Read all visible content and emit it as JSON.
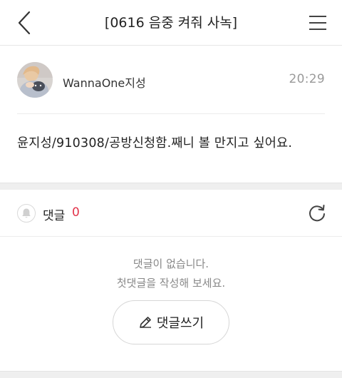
{
  "header": {
    "title": "[0616 음중 켜줘 사녹]",
    "back_icon": "chevron-left-icon",
    "menu_icon": "hamburger-menu-icon"
  },
  "post": {
    "author": "WannaOne지성",
    "time": "20:29",
    "body": "윤지성/910308/공방신청함.째니 볼 만지고 싶어요."
  },
  "comments": {
    "label": "댓글",
    "count": "0",
    "empty_line1": "댓글이 없습니다.",
    "empty_line2": "첫댓글을 작성해 보세요.",
    "write_label": "댓글쓰기",
    "count_color": "#e2344b"
  }
}
